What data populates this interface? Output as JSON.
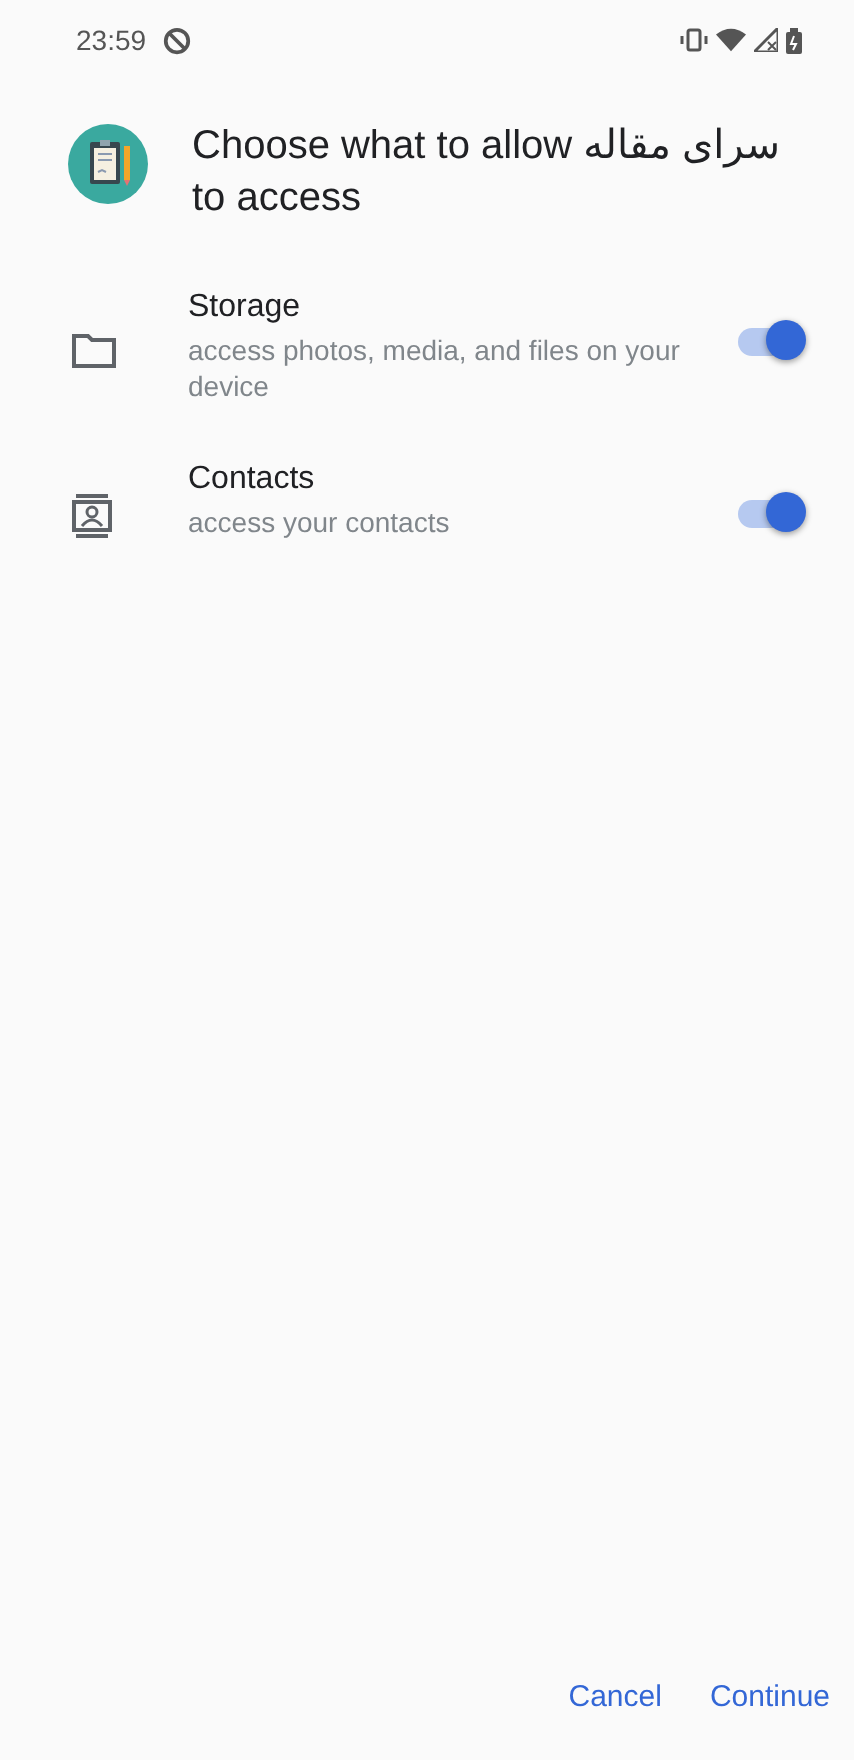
{
  "status_bar": {
    "time": "23:59"
  },
  "title": "Choose what to allow سرای مقاله to access",
  "permissions": [
    {
      "kind": "folder",
      "name": "Storage",
      "description": "access photos, media, and files on your device",
      "on": true
    },
    {
      "kind": "contacts",
      "name": "Contacts",
      "description": "access your contacts",
      "on": true
    }
  ],
  "buttons": [
    "Cancel",
    "Continue"
  ]
}
